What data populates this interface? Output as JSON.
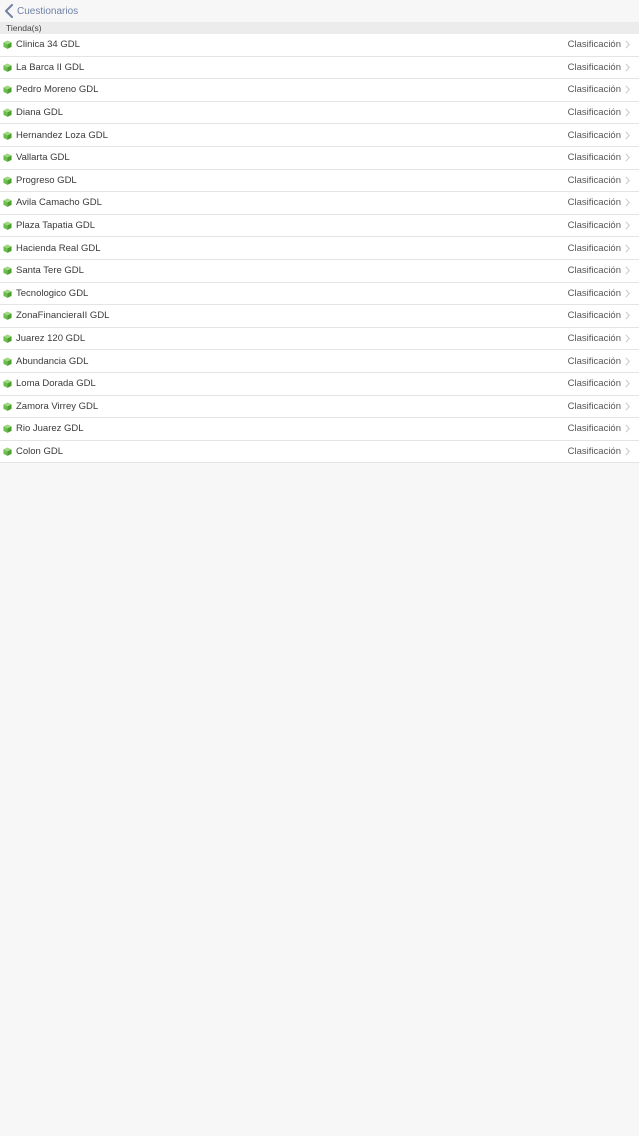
{
  "navbar": {
    "back_label": "Cuestionarios"
  },
  "section": {
    "header": "Tienda(s)"
  },
  "colors": {
    "accent": "#6f82a5",
    "cube_green": "#6cbf4a"
  },
  "stores": [
    {
      "name": "Clinica 34 GDL",
      "detail": "Clasificación"
    },
    {
      "name": "La Barca II GDL",
      "detail": "Clasificación"
    },
    {
      "name": "Pedro Moreno GDL",
      "detail": "Clasificación"
    },
    {
      "name": "Diana GDL",
      "detail": "Clasificación"
    },
    {
      "name": "Hernandez Loza GDL",
      "detail": "Clasificación"
    },
    {
      "name": "Vallarta GDL",
      "detail": "Clasificación"
    },
    {
      "name": "Progreso GDL",
      "detail": "Clasificación"
    },
    {
      "name": "Avila Camacho GDL",
      "detail": "Clasificación"
    },
    {
      "name": "Plaza Tapatia GDL",
      "detail": "Clasificación"
    },
    {
      "name": "Hacienda Real GDL",
      "detail": "Clasificación"
    },
    {
      "name": "Santa Tere GDL",
      "detail": "Clasificación"
    },
    {
      "name": "Tecnologico GDL",
      "detail": "Clasificación"
    },
    {
      "name": "ZonaFinancieraII GDL",
      "detail": "Clasificación"
    },
    {
      "name": "Juarez 120 GDL",
      "detail": "Clasificación"
    },
    {
      "name": "Abundancia GDL",
      "detail": "Clasificación"
    },
    {
      "name": "Loma Dorada GDL",
      "detail": "Clasificación"
    },
    {
      "name": "Zamora Virrey GDL",
      "detail": "Clasificación"
    },
    {
      "name": "Rio Juarez GDL",
      "detail": "Clasificación"
    },
    {
      "name": "Colon GDL",
      "detail": "Clasificación"
    }
  ]
}
